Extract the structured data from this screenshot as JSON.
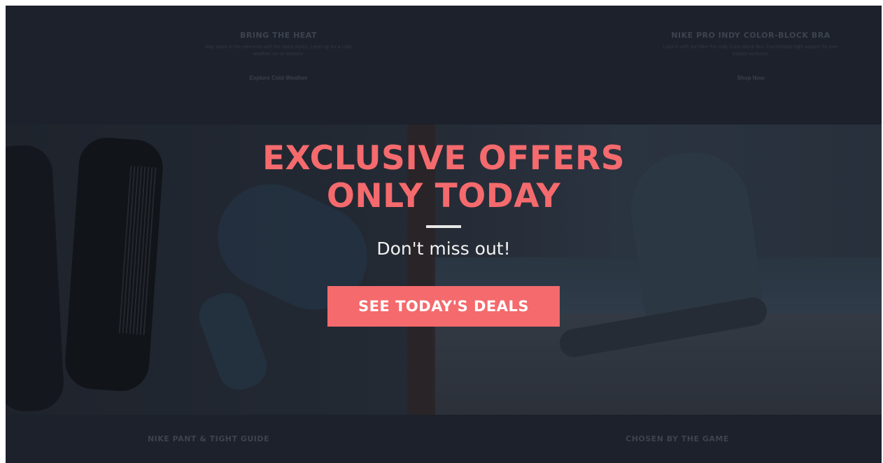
{
  "background_page": {
    "top_promos": [
      {
        "title": "BRING THE HEAT",
        "description": "Stay warm in the elements with the latest styles. Layer up for a cold-weather run or workout.",
        "link": "Explore Cold Weather"
      },
      {
        "title": "NIKE PRO INDY COLOR-BLOCK BRA",
        "description": "Lock in with the Nike Pro Indy Color-Block Bra. Comfortable light support for low-impact workouts.",
        "link": "Shop Now"
      }
    ],
    "bottom_promos": [
      {
        "title": "NIKE PANT & TIGHT GUIDE"
      },
      {
        "title": "CHOSEN BY THE GAME"
      }
    ]
  },
  "hero": {
    "headline_line1": "EXCLUSIVE OFFERS",
    "headline_line2": "ONLY TODAY",
    "subline": "Don't miss out!",
    "cta_label": "SEE TODAY'S DEALS"
  },
  "colors": {
    "accent": "#f46a6d",
    "overlay": "#1b1f28",
    "text_light": "#f2f2f2"
  }
}
